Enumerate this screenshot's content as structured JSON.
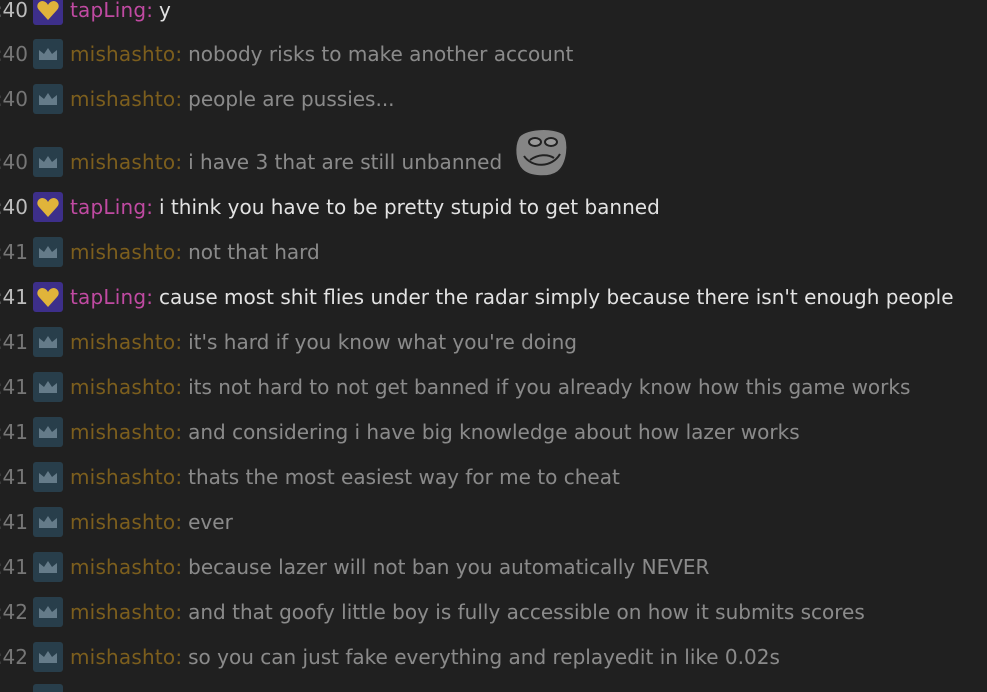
{
  "messages": [
    {
      "time": ":40",
      "user": "tapLing",
      "badge": "heart-icon",
      "text": "y",
      "dim": false
    },
    {
      "time": ":40",
      "user": "mishashto",
      "badge": "crown-icon",
      "text": "nobody risks to make another account",
      "dim": true
    },
    {
      "time": ":40",
      "user": "mishashto",
      "badge": "crown-icon",
      "text": "people are pussies...",
      "dim": true
    },
    {
      "time": ":40",
      "user": "mishashto",
      "badge": "crown-icon",
      "text": "i have 3 that are still unbanned",
      "dim": true,
      "emote": "trollface-emote"
    },
    {
      "time": ":40",
      "user": "tapLing",
      "badge": "heart-icon",
      "text": "i think you have to be pretty stupid to get banned",
      "dim": false
    },
    {
      "time": ":41",
      "user": "mishashto",
      "badge": "crown-icon",
      "text": "not that hard",
      "dim": true
    },
    {
      "time": ":41",
      "user": "tapLing",
      "badge": "heart-icon",
      "text": "cause most shit flies under the radar simply because there isn't enough people",
      "dim": false
    },
    {
      "time": ":41",
      "user": "mishashto",
      "badge": "crown-icon",
      "text": "it's hard if you know what you're doing",
      "dim": true
    },
    {
      "time": ":41",
      "user": "mishashto",
      "badge": "crown-icon",
      "text": "its not hard to not get banned if you already know how this game works",
      "dim": true
    },
    {
      "time": ":41",
      "user": "mishashto",
      "badge": "crown-icon",
      "text": "and considering i have big knowledge about how lazer works",
      "dim": true
    },
    {
      "time": ":41",
      "user": "mishashto",
      "badge": "crown-icon",
      "text": "thats the most easiest way for me to cheat",
      "dim": true
    },
    {
      "time": ":41",
      "user": "mishashto",
      "badge": "crown-icon",
      "text": "ever",
      "dim": true
    },
    {
      "time": ":41",
      "user": "mishashto",
      "badge": "crown-icon",
      "text": "because lazer will not ban you automatically NEVER",
      "dim": true
    },
    {
      "time": ":42",
      "user": "mishashto",
      "badge": "crown-icon",
      "text": "and that goofy little boy is fully accessible on how it submits scores",
      "dim": true
    },
    {
      "time": ":42",
      "user": "mishashto",
      "badge": "crown-icon",
      "text": "so you can just fake everything and replayedit in like 0.02s",
      "dim": true
    }
  ],
  "colors": {
    "background": "#202020",
    "misha_name": "#c8921c",
    "tap_name": "#c04aa2",
    "message_text": "#e2e2e2",
    "crown_badge_bg": "#2f586f",
    "heart_badge_bg": "#3d2f8a",
    "heart_icon": "#e0b43a"
  }
}
